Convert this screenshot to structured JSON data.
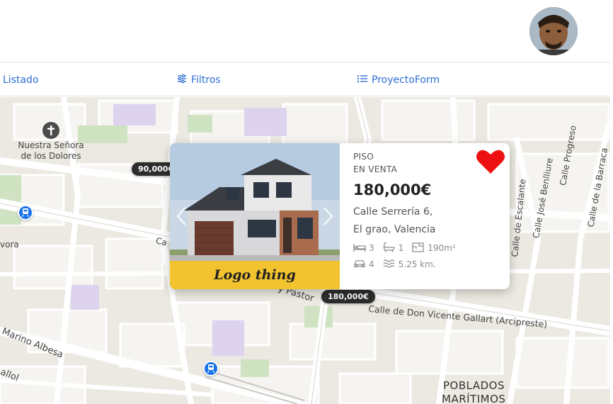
{
  "nav": {
    "listado": "Listado",
    "filtros": "Filtros",
    "proyecto": "ProyectoForm"
  },
  "map": {
    "labels": {
      "church": "Nuestra Señora\nde los Dolores",
      "vora": "vora",
      "ca": "Ca",
      "pastor": "y Pastor",
      "gallart": "Calle de Don Vicente Gallart (Arcipreste)",
      "escalante": "Calle de Escalante",
      "benlliure": "Calle José Benlliure",
      "progreso": "Calle Progreso",
      "barraca": "Calle de la Barraca",
      "marino": "Marino Albesa",
      "allol": "allol",
      "poblados1": "POBLADOS",
      "poblados2": "MARÍTIMOS"
    },
    "pins": {
      "pin1": "90,000€",
      "pin2": "180,000€"
    }
  },
  "card": {
    "type_line1": "PISO",
    "type_line2": "EN VENTA",
    "price": "180,000€",
    "address_line1": "Calle Serrería 6,",
    "address_line2": "El grao, Valencia",
    "bedrooms": "3",
    "bathrooms": "1",
    "area": "190m²",
    "parking": "4",
    "distance": "5.25 km.",
    "logo": "Logo thing",
    "favorite": true
  },
  "colors": {
    "accent": "#2f6fd1",
    "heart": "#ee1111",
    "logo_band": "#f2c32e",
    "pin_bg": "#2c2c2c",
    "transit": "#1a73e8"
  },
  "icons": {
    "listado": "list-icon",
    "filtros": "sliders-icon",
    "proyecto": "list-icon",
    "bed": "bed-icon",
    "bath": "bathtub-icon",
    "area": "floor-plan-icon",
    "parking": "car-icon",
    "distance": "waves-icon",
    "favorite": "heart-icon"
  }
}
